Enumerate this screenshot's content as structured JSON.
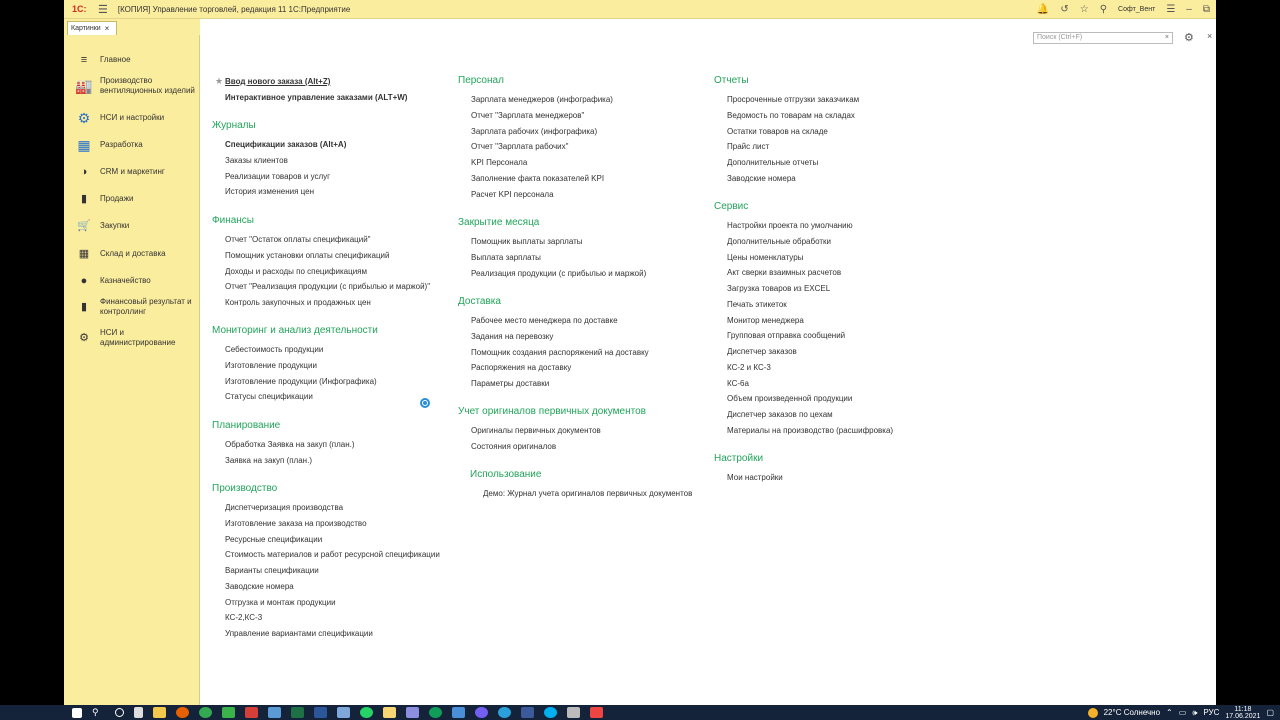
{
  "titlebar": {
    "logo": "1С:",
    "title": "[КОПИЯ] Управление торговлей, редакция 11 1С:Предприятие",
    "user": "Софт_Вент"
  },
  "tab": {
    "label": "Картинки",
    "close": "×"
  },
  "sidebar": {
    "items": [
      {
        "label": "Главное",
        "icon": "≡"
      },
      {
        "label": "Производство вентиляционных изделий",
        "icon": "🏭"
      },
      {
        "label": "НСИ и настройки",
        "icon": "⚙"
      },
      {
        "label": "Разработка",
        "icon": "▦"
      },
      {
        "label": "CRM и маркетинг",
        "icon": "◑"
      },
      {
        "label": "Продажи",
        "icon": "▮"
      },
      {
        "label": "Закупки",
        "icon": "🛒"
      },
      {
        "label": "Склад и доставка",
        "icon": "▦"
      },
      {
        "label": "Казначейство",
        "icon": "●"
      },
      {
        "label": "Финансовый результат и контроллинг",
        "icon": "▮"
      },
      {
        "label": "НСИ и администрирование",
        "icon": "⚙"
      }
    ]
  },
  "search": {
    "placeholder": "Поиск (Ctrl+F)",
    "clear": "×"
  },
  "col1": {
    "top_links": [
      "Ввод нового заказа (Alt+Z)",
      "Интерактивное управление заказами (ALT+W)"
    ],
    "sections": [
      {
        "title": "Журналы",
        "items": [
          "Спецификации заказов (Alt+A)",
          "Заказы клиентов",
          "Реализации товаров и услуг",
          "История изменения цен"
        ]
      },
      {
        "title": "Финансы",
        "items": [
          "Отчет \"Остаток оплаты спецификаций\"",
          "Помощник установки оплаты спецификаций",
          "Доходы и расходы по спецификациям",
          "Отчет \"Реализация продукции (с прибылью и маржой)\"",
          "Контроль закупочных и продажных цен"
        ]
      },
      {
        "title": "Мониторинг и анализ деятельности",
        "items": [
          "Себестоимость продукции",
          "Изготовление продукции",
          "Изготовление продукции (Инфографика)",
          "Статусы спецификации"
        ]
      },
      {
        "title": "Планирование",
        "items": [
          "Обработка Заявка на закуп (план.)",
          "Заявка на закуп (план.)"
        ]
      },
      {
        "title": "Производство",
        "items": [
          "Диспетчеризация производства",
          "Изготовление заказа на производство",
          "Ресурсные спецификации",
          "Стоимость материалов и работ ресурсной спецификации",
          "Варианты спецификации",
          "Заводские номера",
          "Отгрузка и монтаж продукции",
          "КС-2,КС-3",
          "Управление вариантами спецификации"
        ]
      }
    ]
  },
  "col2": {
    "sections": [
      {
        "title": "Персонал",
        "items": [
          "Зарплата менеджеров (инфографика)",
          "Отчет \"Зарплата менеджеров\"",
          "Зарплата рабочих (инфографика)",
          "Отчет \"Зарплата рабочих\"",
          "KPI Персонала",
          "Заполнение факта показателей KPI",
          "Расчет KPI персонала"
        ]
      },
      {
        "title": "Закрытие месяца",
        "items": [
          "Помощник выплаты зарплаты",
          "Выплата зарплаты",
          "Реализация продукции (с прибылью и маржой)"
        ]
      },
      {
        "title": "Доставка",
        "items": [
          "Рабочее место менеджера по доставке",
          "Задания на перевозку",
          "Помощник создания распоряжений на доставку",
          "Распоряжения на доставку",
          "Параметры доставки"
        ]
      },
      {
        "title": "Учет оригиналов первичных документов",
        "items": [
          "Оригиналы первичных документов",
          "Состояния оригиналов"
        ]
      },
      {
        "title": "Использование",
        "items": [
          "Демо: Журнал учета оригиналов первичных документов"
        ]
      }
    ]
  },
  "col3": {
    "sections": [
      {
        "title": "Отчеты",
        "items": [
          "Просроченные отгрузки заказчикам",
          "Ведомость по товарам на складах",
          "Остатки товаров на складе",
          "Прайс лист",
          "Дополнительные отчеты",
          "Заводские номера"
        ]
      },
      {
        "title": "Сервис",
        "items": [
          "Настройки проекта по умолчанию",
          "Дополнительные обработки",
          "Цены номенклатуры",
          "Акт сверки взаимных расчетов",
          "Загрузка товаров из EXCEL",
          "Печать этикеток",
          "Монитор менеджера",
          "Групповая отправка сообщений",
          "Диспетчер заказов",
          "КС-2 и КС-3",
          "КС-6а",
          "Объем произведенной продукции",
          "Диспетчер заказов по цехам",
          "Материалы на производство (расшифровка)"
        ]
      },
      {
        "title": "Настройки",
        "items": [
          "Мои настройки"
        ]
      }
    ]
  },
  "taskbar": {
    "weather": "22°C Солнечно",
    "lang": "РУС",
    "time": "11:18",
    "date": "17.06.2021"
  }
}
